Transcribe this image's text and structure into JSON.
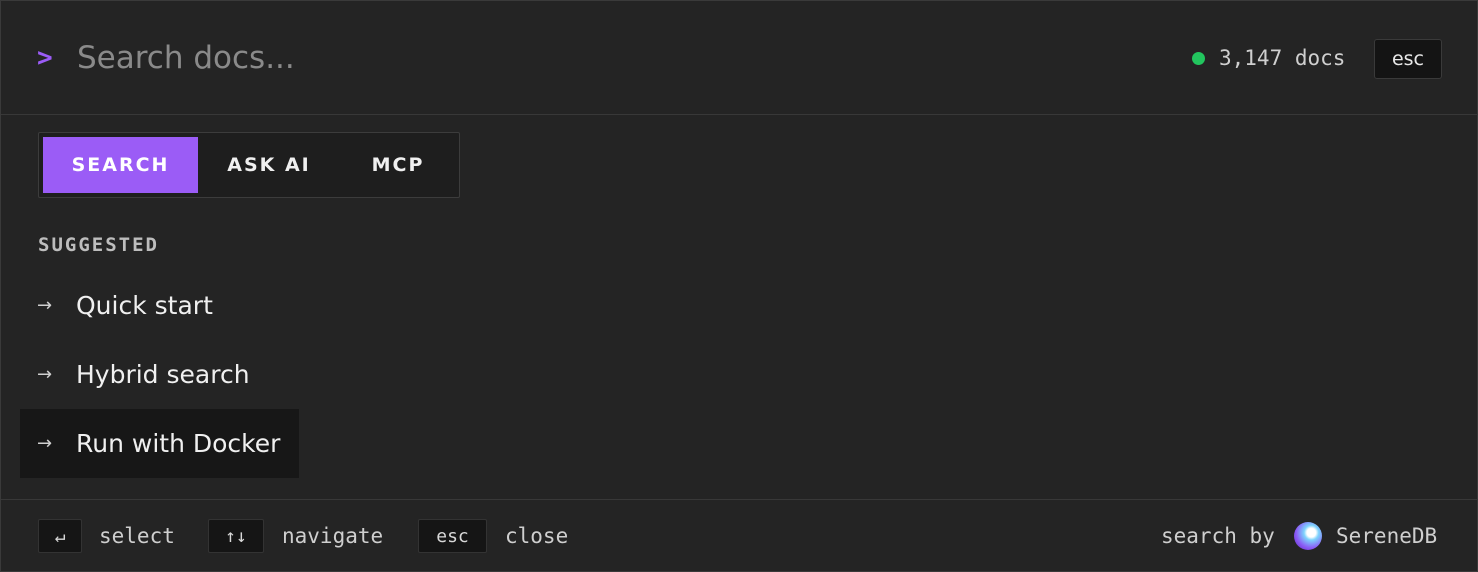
{
  "search": {
    "prompt_symbol": ">",
    "placeholder": "Search docs...",
    "status_text": "3,147 docs",
    "status_color": "#22c55e",
    "esc_label": "esc"
  },
  "tabs": [
    {
      "label": "SEARCH",
      "active": true
    },
    {
      "label": "ASK AI",
      "active": false
    },
    {
      "label": "MCP",
      "active": false
    }
  ],
  "suggested": {
    "heading": "SUGGESTED",
    "arrow": "→",
    "items": [
      {
        "label": "Quick start",
        "highlighted": false
      },
      {
        "label": "Hybrid search",
        "highlighted": false
      },
      {
        "label": "Run with Docker",
        "highlighted": true
      }
    ]
  },
  "footer": {
    "hints": [
      {
        "key": "↵",
        "label": "select"
      },
      {
        "key": "↑↓",
        "label": "navigate"
      },
      {
        "key": "esc",
        "label": "close"
      }
    ],
    "attribution_prefix": "search by",
    "brand_name": "SereneDB",
    "brand_icon": "serenedb-logo-icon"
  },
  "colors": {
    "accent": "#9b5cf6",
    "background": "#242424",
    "highlight": "#171717"
  }
}
